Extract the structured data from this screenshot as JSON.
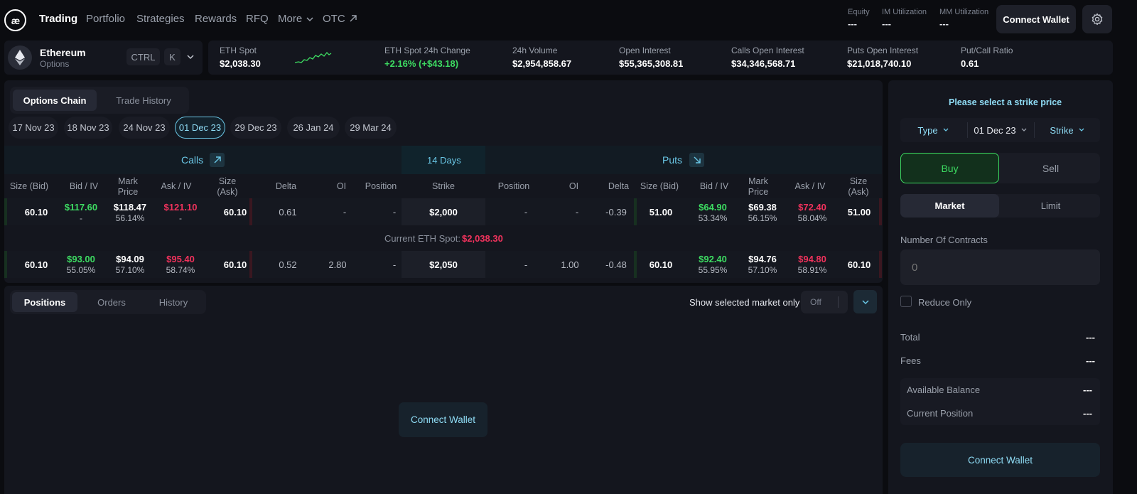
{
  "nav": {
    "logo_text": "æ",
    "items": [
      "Trading",
      "Portfolio",
      "Strategies",
      "Rewards",
      "RFQ",
      "More",
      "OTC"
    ],
    "stats": [
      {
        "label": "Equity",
        "value": "---"
      },
      {
        "label": "IM Utilization",
        "value": "---"
      },
      {
        "label": "MM Utilization",
        "value": "---"
      }
    ],
    "connect_wallet": "Connect Wallet"
  },
  "market": {
    "name": "Ethereum",
    "sub": "Options",
    "kbd1": "CTRL",
    "kbd2": "K"
  },
  "ticker": [
    {
      "label": "ETH Spot",
      "value": "$2,038.30"
    },
    {
      "label": "ETH Spot 24h Change",
      "value": "+2.16% (+$43.18)"
    },
    {
      "label": "24h Volume",
      "value": "$2,954,858.67"
    },
    {
      "label": "Open Interest",
      "value": "$55,365,308.81"
    },
    {
      "label": "Calls Open Interest",
      "value": "$34,346,568.71"
    },
    {
      "label": "Puts Open Interest",
      "value": "$21,018,740.10"
    },
    {
      "label": "Put/Call Ratio",
      "value": "0.61"
    }
  ],
  "chain": {
    "tabs": [
      "Options Chain",
      "Trade History"
    ],
    "dates": [
      "17 Nov 23",
      "18 Nov 23",
      "24 Nov 23",
      "01 Dec 23",
      "29 Dec 23",
      "26 Jan 24",
      "29 Mar 24"
    ],
    "calls": "Calls",
    "days": "14 Days",
    "puts": "Puts",
    "columns": {
      "size_bid": [
        "Size (Bid)"
      ],
      "bid_iv": [
        "Bid / IV"
      ],
      "mark": [
        "Mark",
        "Price"
      ],
      "ask_iv": [
        "Ask / IV"
      ],
      "size_ask": [
        "Size",
        "(Ask)"
      ],
      "delta": "Delta",
      "oi": "OI",
      "position": "Position",
      "strike": "Strike"
    },
    "rows": [
      {
        "c_size_bid": "60.10",
        "c_bid": "$117.60",
        "c_bid_iv": "-",
        "c_mark": "$118.47",
        "c_mark_iv": "56.14%",
        "c_ask": "$121.10",
        "c_ask_iv": "-",
        "c_size_ask": "60.10",
        "c_delta": "0.61",
        "c_oi": "-",
        "c_pos": "-",
        "strike": "$2,000",
        "p_pos": "-",
        "p_oi": "-",
        "p_delta": "-0.39",
        "p_size_bid": "51.00",
        "p_bid": "$64.90",
        "p_bid_iv": "53.34%",
        "p_mark": "$69.38",
        "p_mark_iv": "56.15%",
        "p_ask": "$72.40",
        "p_ask_iv": "58.04%",
        "p_size_ask": "51.00"
      },
      {
        "c_size_bid": "60.10",
        "c_bid": "$93.00",
        "c_bid_iv": "55.05%",
        "c_mark": "$94.09",
        "c_mark_iv": "57.10%",
        "c_ask": "$95.40",
        "c_ask_iv": "58.74%",
        "c_size_ask": "60.10",
        "c_delta": "0.52",
        "c_oi": "2.80",
        "c_pos": "-",
        "strike": "$2,050",
        "p_pos": "-",
        "p_oi": "1.00",
        "p_delta": "-0.48",
        "p_size_bid": "60.10",
        "p_bid": "$92.40",
        "p_bid_iv": "55.95%",
        "p_mark": "$94.76",
        "p_mark_iv": "57.10%",
        "p_ask": "$94.80",
        "p_ask_iv": "58.91%",
        "p_size_ask": "60.10"
      }
    ],
    "spot_label": "Current ETH Spot:",
    "spot_value": "$2,038.30"
  },
  "positions": {
    "tabs": [
      "Positions",
      "Orders",
      "History"
    ],
    "show_selected": "Show selected market only",
    "toggle": "Off",
    "connect_wallet": "Connect Wallet"
  },
  "order": {
    "prompt": "Please select a strike price",
    "type": "Type",
    "date": "01 Dec 23",
    "strike": "Strike",
    "buy": "Buy",
    "sell": "Sell",
    "market": "Market",
    "limit": "Limit",
    "contracts_label": "Number Of Contracts",
    "contracts_placeholder": "0",
    "reduce_only": "Reduce Only",
    "total_label": "Total",
    "total_value": "---",
    "fees_label": "Fees",
    "fees_value": "---",
    "avail_label": "Available Balance",
    "avail_value": "---",
    "curpos_label": "Current Position",
    "curpos_value": "---",
    "connect_wallet": "Connect Wallet"
  },
  "colors": {
    "accent": "#6ac7e6",
    "green": "#3ddc62",
    "red": "#f0325c",
    "bg": "#0b0c10",
    "panel": "#14161e"
  }
}
